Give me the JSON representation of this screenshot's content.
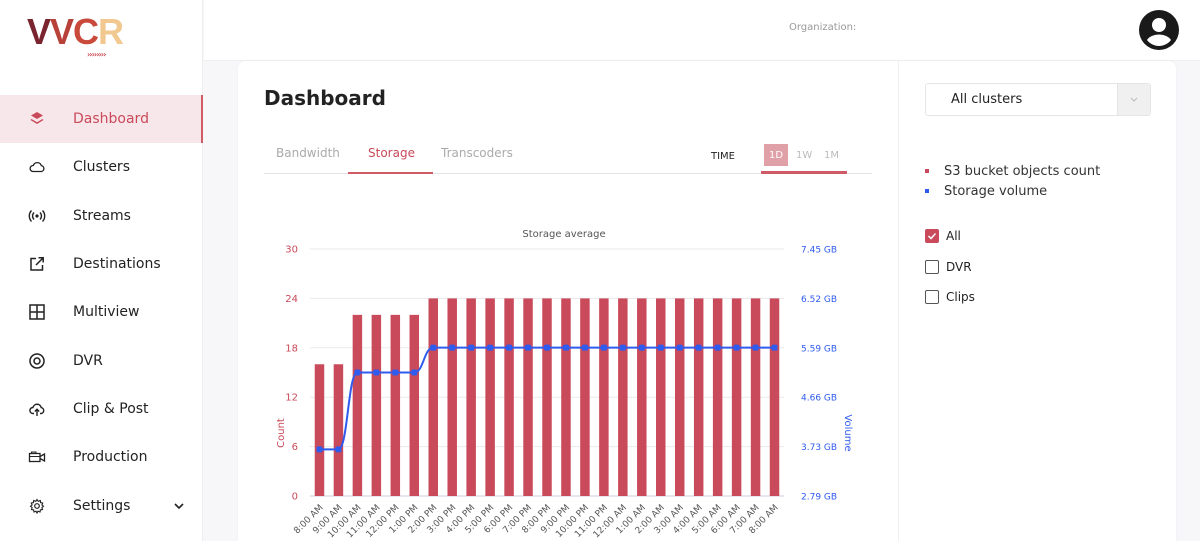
{
  "app": {
    "logo": {
      "letters": [
        "V",
        "V",
        "C",
        "R"
      ],
      "arrows": "››››››››"
    }
  },
  "sidebar": {
    "items": [
      {
        "label": "Dashboard",
        "icon": "layers-icon",
        "active": true
      },
      {
        "label": "Clusters",
        "icon": "cloud-icon"
      },
      {
        "label": "Streams",
        "icon": "broadcast-icon"
      },
      {
        "label": "Destinations",
        "icon": "external-link-icon"
      },
      {
        "label": "Multiview",
        "icon": "grid-icon"
      },
      {
        "label": "DVR",
        "icon": "record-icon"
      },
      {
        "label": "Clip & Post",
        "icon": "cloud-upload-icon"
      },
      {
        "label": "Production",
        "icon": "video-camera-icon"
      },
      {
        "label": "Settings",
        "icon": "gear-icon",
        "expandable": true
      }
    ]
  },
  "header": {
    "organization_label": "Organization:",
    "avatar_icon": "user-avatar-icon"
  },
  "main": {
    "title": "Dashboard",
    "tabs": [
      {
        "label": "Bandwidth"
      },
      {
        "label": "Storage",
        "active": true
      },
      {
        "label": "Transcoders"
      }
    ],
    "time": {
      "label": "TIME",
      "options": [
        {
          "label": "1D",
          "active": true
        },
        {
          "label": "1W"
        },
        {
          "label": "1M"
        }
      ]
    }
  },
  "right_panel": {
    "cluster_select": {
      "value": "All clusters"
    },
    "legend": [
      {
        "label": "S3 bucket objects count",
        "color": "#c94a5a"
      },
      {
        "label": "Storage volume",
        "color": "#2f5bef"
      }
    ],
    "filters": [
      {
        "label": "All",
        "checked": true
      },
      {
        "label": "DVR",
        "checked": false
      },
      {
        "label": "Clips",
        "checked": false
      }
    ]
  },
  "chart_data": {
    "type": "bar",
    "title": "Storage average",
    "xlabel": "",
    "ylabel": "Count",
    "y2label": "Volume",
    "grid": true,
    "categories": [
      "8:00 AM",
      "9:00 AM",
      "10:00 AM",
      "11:00 AM",
      "12:00 PM",
      "1:00 PM",
      "2:00 PM",
      "3:00 PM",
      "4:00 PM",
      "5:00 PM",
      "6:00 PM",
      "7:00 PM",
      "8:00 PM",
      "9:00 PM",
      "10:00 PM",
      "11:00 PM",
      "12:00 AM",
      "1:00 AM",
      "2:00 AM",
      "3:00 AM",
      "4:00 AM",
      "5:00 AM",
      "6:00 AM",
      "7:00 AM",
      "8:00 AM"
    ],
    "ylim": [
      0,
      30
    ],
    "yticks": [
      "0",
      "6",
      "12",
      "18",
      "24",
      "30"
    ],
    "y2lim": [
      2.79,
      7.45
    ],
    "y2ticks": [
      "2.79 GB",
      "3.73 GB",
      "4.66 GB",
      "5.59 GB",
      "6.52 GB",
      "7.45 GB"
    ],
    "series": [
      {
        "name": "S3 bucket objects count",
        "type": "bar",
        "axis": "left",
        "color": "#c94a5a",
        "values": [
          16,
          16,
          22,
          22,
          22,
          22,
          24,
          24,
          24,
          24,
          24,
          24,
          24,
          24,
          24,
          24,
          24,
          24,
          24,
          24,
          24,
          24,
          24,
          24,
          24
        ]
      },
      {
        "name": "Storage volume",
        "type": "line",
        "axis": "right",
        "unit": "GB",
        "color": "#2f5bef",
        "values": [
          3.67,
          3.67,
          5.12,
          5.12,
          5.12,
          5.12,
          5.59,
          5.59,
          5.59,
          5.59,
          5.59,
          5.59,
          5.59,
          5.59,
          5.59,
          5.59,
          5.59,
          5.59,
          5.59,
          5.59,
          5.59,
          5.59,
          5.59,
          5.59,
          5.59
        ]
      }
    ]
  }
}
